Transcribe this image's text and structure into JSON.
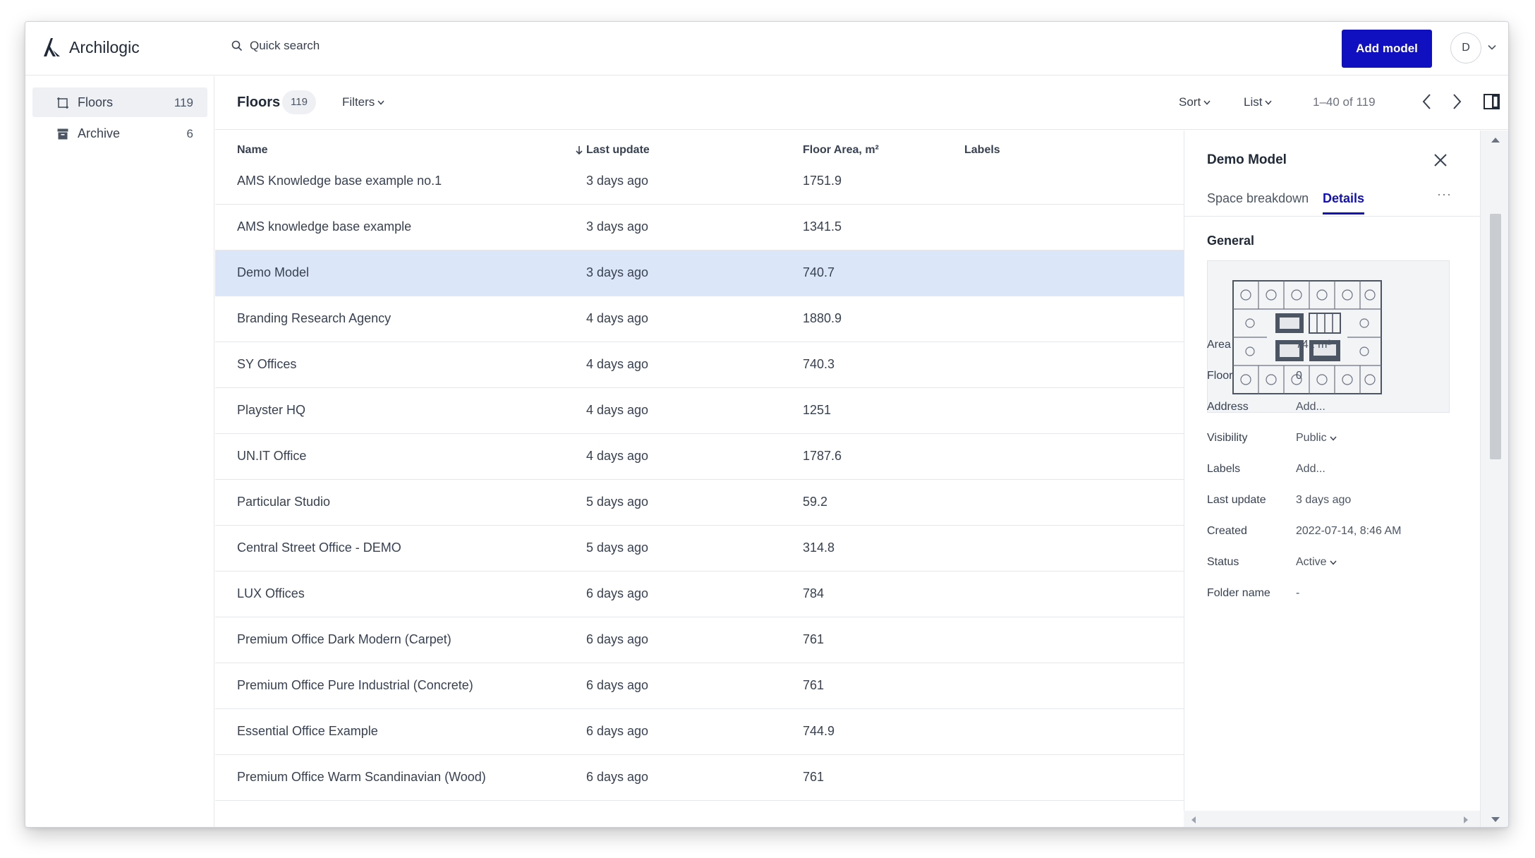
{
  "app": {
    "logo_text": "Archilogic",
    "search_label": "Quick search",
    "add_button": "Add model",
    "avatar_initial": "D"
  },
  "sidebar": {
    "items": [
      {
        "label": "Floors",
        "count": "119",
        "icon": "floor-plan-icon"
      },
      {
        "label": "Archive",
        "count": "6",
        "icon": "archive-icon"
      }
    ]
  },
  "toolbar": {
    "title": "Floors",
    "count": "119",
    "filters": "Filters",
    "sort": "Sort",
    "view": "List",
    "range": "1–40 of 119"
  },
  "table": {
    "headers": {
      "name": "Name",
      "last_update": "Last update",
      "floor_area": "Floor Area, m²",
      "labels": "Labels"
    },
    "rows": [
      {
        "name": "AMS Knowledge base example no.1",
        "updated": "3 days ago",
        "area": "1751.9"
      },
      {
        "name": "AMS knowledge base example",
        "updated": "3 days ago",
        "area": "1341.5"
      },
      {
        "name": "Demo Model",
        "updated": "3 days ago",
        "area": "740.7"
      },
      {
        "name": "Branding Research Agency",
        "updated": "4 days ago",
        "area": "1880.9"
      },
      {
        "name": "SY Offices",
        "updated": "4 days ago",
        "area": "740.3"
      },
      {
        "name": "Playster HQ",
        "updated": "4 days ago",
        "area": "1251"
      },
      {
        "name": "UN.IT Office",
        "updated": "4 days ago",
        "area": "1787.6"
      },
      {
        "name": "Particular Studio",
        "updated": "5 days ago",
        "area": "59.2"
      },
      {
        "name": "Central Street Office - DEMO",
        "updated": "5 days ago",
        "area": "314.8"
      },
      {
        "name": "LUX Offices",
        "updated": "6 days ago",
        "area": "784"
      },
      {
        "name": "Premium Office Dark Modern (Carpet)",
        "updated": "6 days ago",
        "area": "761"
      },
      {
        "name": "Premium Office Pure Industrial (Concrete)",
        "updated": "6 days ago",
        "area": "761"
      },
      {
        "name": "Essential Office Example",
        "updated": "6 days ago",
        "area": "744.9"
      },
      {
        "name": "Premium Office Warm Scandinavian (Wood)",
        "updated": "6 days ago",
        "area": "761"
      }
    ]
  },
  "details": {
    "title": "Demo Model",
    "tabs": [
      "Space breakdown",
      "Details"
    ],
    "active_tab": "Details",
    "more": "···",
    "section": "General",
    "fields": [
      {
        "label": "Area",
        "value": "741 m²"
      },
      {
        "label": "Floor",
        "value": "0"
      },
      {
        "label": "Address",
        "value": "Add..."
      },
      {
        "label": "Visibility",
        "value": "Public",
        "dropdown": true
      },
      {
        "label": "Labels",
        "value": "Add..."
      },
      {
        "label": "Last update",
        "value": "3 days ago"
      },
      {
        "label": "Created",
        "value": "2022-07-14, 8:46 AM"
      },
      {
        "label": "Status",
        "value": "Active",
        "dropdown": true
      },
      {
        "label": "Folder name",
        "value": "-"
      }
    ]
  },
  "colors": {
    "accent": "#1010c0",
    "selected_row": "#dbe7f8",
    "border": "#e5e7eb"
  }
}
